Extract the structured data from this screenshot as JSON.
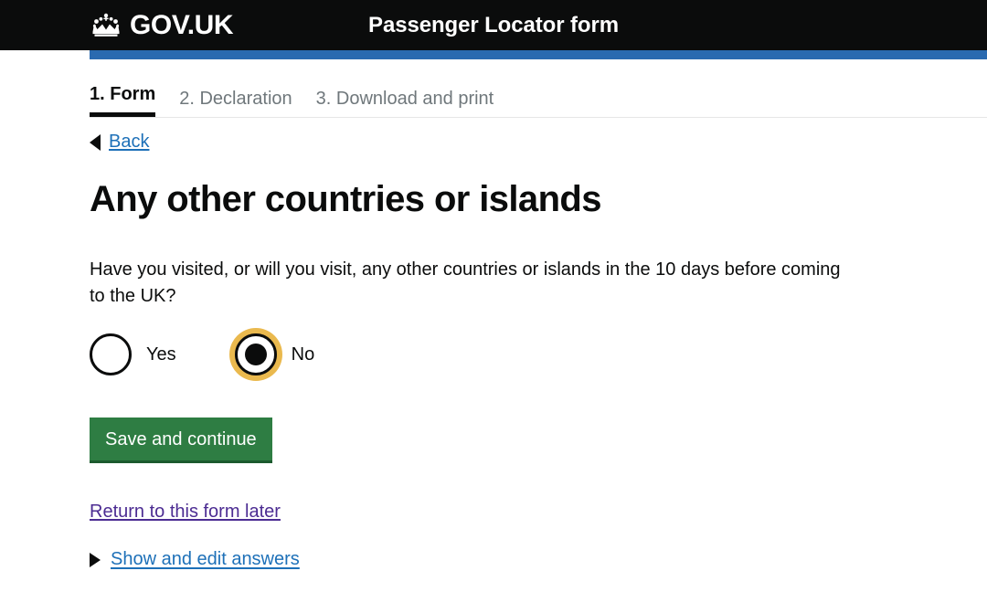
{
  "header": {
    "brand_name": "GOV.UK",
    "crown_icon": "crown-icon",
    "service_title": "Passenger Locator form"
  },
  "tabs": [
    {
      "label": "1. Form",
      "active": true
    },
    {
      "label": "2. Declaration",
      "active": false
    },
    {
      "label": "3. Download and print",
      "active": false
    }
  ],
  "back": {
    "label": "Back",
    "icon": "triangle-left-icon"
  },
  "main": {
    "heading": "Any other countries or islands",
    "question": "Have you visited, or will you visit, any other countries or islands in the 10 days before coming to the UK?",
    "radios": [
      {
        "label": "Yes",
        "checked": false,
        "focused": false
      },
      {
        "label": "No",
        "checked": true,
        "focused": true
      }
    ],
    "save_button": "Save and continue",
    "return_link": "Return to this form later",
    "details": {
      "label": "Show and edit answers",
      "icon": "triangle-right-icon"
    }
  },
  "colors": {
    "header_bg": "#0b0c0c",
    "blue_stripe": "#2a6ab0",
    "link_blue": "#1d70b8",
    "link_visited_purple": "#4c2c92",
    "button_green": "#2e7d43",
    "focus_yellow": "#eab94e",
    "muted_text": "#6f777b"
  }
}
